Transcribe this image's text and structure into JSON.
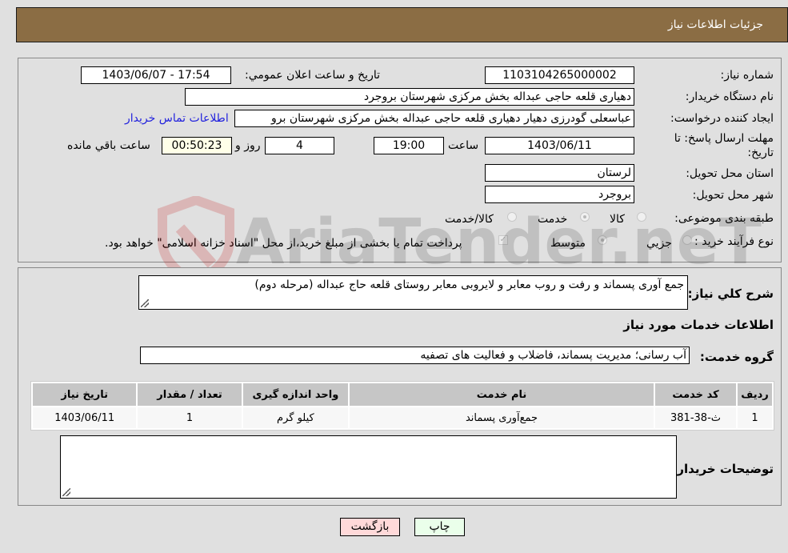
{
  "header": {
    "title": "جزئیات اطلاعات نیاز"
  },
  "details": {
    "need_number_label": "شماره نیاز:",
    "need_number": "1103104265000002",
    "announce_label": "تاریخ و ساعت اعلان عمومي:",
    "announce_value": "1403/06/07 - 17:54",
    "buyer_org_label": "نام دستگاه خریدار:",
    "buyer_org": "دهیاری قلعه حاجی عبداله بخش مرکزی شهرستان بروجرد",
    "creator_label": "ایجاد کننده درخواست:",
    "creator": "عباسعلی گودرزی دهیار دهیاری قلعه حاجی عبداله بخش مرکزی شهرستان برو",
    "contact_link": "اطلاعات تماس خریدار",
    "deadline_label_1": "مهلت ارسال پاسخ: تا",
    "deadline_label_2": "تاریخ:",
    "deadline_date": "1403/06/11",
    "time_label": "ساعت",
    "deadline_time": "19:00",
    "days_value": "4",
    "days_label": "روز و",
    "remaining_time": "00:50:23",
    "remaining_label": "ساعت باقي مانده",
    "province_label": "استان محل تحویل:",
    "province": "لرستان",
    "city_label": "شهر محل تحویل:",
    "city": "بروجرد",
    "category_label": "طبقه بندی موضوعی:",
    "category_options": [
      {
        "label": "کالا",
        "checked": false
      },
      {
        "label": "خدمت",
        "checked": true
      },
      {
        "label": "کالا/خدمت",
        "checked": false
      }
    ],
    "process_label": "نوع فرآیند خرید :",
    "process_options": [
      {
        "label": "جزيي",
        "checked": false
      },
      {
        "label": "متوسط",
        "checked": true
      }
    ],
    "treasury_note": "پرداخت تمام یا بخشی از مبلغ خرید،از محل \"اسناد خزانه اسلامی\" خواهد بود."
  },
  "summary": {
    "description_label": "شرح کلي نیاز:",
    "description": "جمع آوری پسماند و رفت و روب معابر و لایروبی معابر روستای قلعه حاج عبداله (مرحله دوم)",
    "services_heading": "اطلاعات خدمات مورد نیاز",
    "service_group_label": "گروه خدمت:",
    "service_group": "آب رسانی؛ مدیریت پسماند، فاضلاب و فعالیت های تصفیه"
  },
  "table": {
    "headers": [
      "ردیف",
      "کد خدمت",
      "نام خدمت",
      "واحد اندازه گیری",
      "تعداد / مقدار",
      "تاریخ نیاز"
    ],
    "rows": [
      [
        "1",
        "ث-38-381",
        "جمع‌آوری پسماند",
        "کیلو گرم",
        "1",
        "1403/06/11"
      ]
    ]
  },
  "buyer_notes": {
    "label": "توضیحات خریدار:",
    "value": ""
  },
  "buttons": {
    "print": "چاپ",
    "back": "بازگشت"
  },
  "colors": {
    "header_bg": "#8b6d44",
    "print_bg": "#eaffea",
    "back_bg": "#ffd9d9",
    "link": "#2222dd"
  },
  "watermark": "AriaTender.neT"
}
